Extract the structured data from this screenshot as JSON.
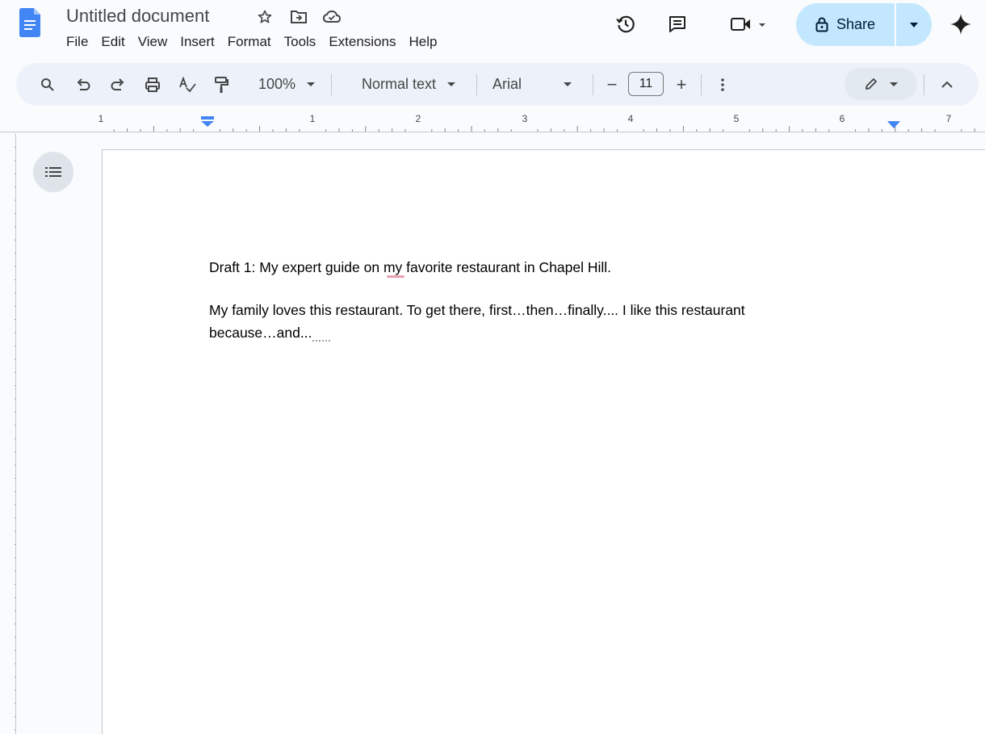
{
  "app": {
    "title": "Untitled document",
    "menu": [
      "File",
      "Edit",
      "View",
      "Insert",
      "Format",
      "Tools",
      "Extensions",
      "Help"
    ],
    "share_label": "Share",
    "icons": {
      "logo": "google-docs-icon",
      "star": "star-icon",
      "move": "move-to-folder-icon",
      "cloud": "cloud-saved-icon",
      "history": "version-history-icon",
      "comments": "comments-icon",
      "meet": "meet-video-icon",
      "lock": "lock-icon",
      "gemini": "gemini-sparkle-icon"
    },
    "accent": "#c2e7ff"
  },
  "toolbar": {
    "zoom": "100%",
    "style": "Normal text",
    "font": "Arial",
    "font_size": "11",
    "minus": "−",
    "plus": "+"
  },
  "ruler": {
    "numbers": [
      "1",
      "1",
      "2",
      "3",
      "4",
      "5",
      "6",
      "7"
    ]
  },
  "document": {
    "lines": [
      "Draft 1: My expert guide on my favorite restaurant in Chapel Hill.",
      "My family loves this restaurant. To get there, first…then…finally.... I like this restaurant",
      "because…and..."
    ]
  }
}
